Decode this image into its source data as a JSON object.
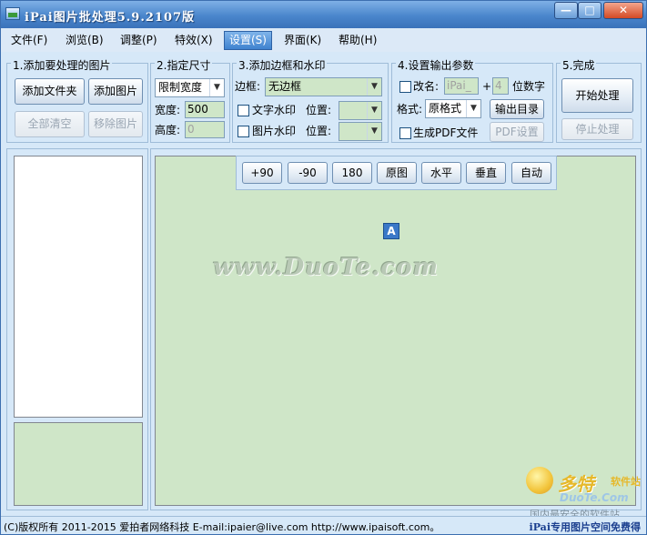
{
  "window": {
    "title": "iPai图片批处理5.9.2107版",
    "min_label": "—",
    "max_label": "□",
    "close_label": "✕"
  },
  "menu": [
    {
      "label": "文件(F)"
    },
    {
      "label": "浏览(B)"
    },
    {
      "label": "调整(P)"
    },
    {
      "label": "特效(X)"
    },
    {
      "label": "设置(S)"
    },
    {
      "label": "界面(K)"
    },
    {
      "label": "帮助(H)"
    }
  ],
  "menu_active_index": 4,
  "step1": {
    "title": "1.添加要处理的图片",
    "add_folder": "添加文件夹",
    "add_image": "添加图片",
    "clear_all": "全部清空",
    "remove_image": "移除图片"
  },
  "step2": {
    "title": "2.指定尺寸",
    "mode": "限制宽度",
    "width_label": "宽度:",
    "width_value": "500",
    "height_label": "高度:",
    "height_value": "0"
  },
  "step3": {
    "title": "3.添加边框和水印",
    "border_label": "边框:",
    "border_value": "无边框",
    "text_watermark": "文字水印",
    "image_watermark": "图片水印",
    "position_label": "位置:"
  },
  "step4": {
    "title": "4.设置输出参数",
    "rename_label": "改名:",
    "rename_value": "iPai_",
    "plus": "+",
    "digits_value": "4",
    "digits_label": "位数字",
    "format_label": "格式:",
    "format_value": "原格式",
    "output_dir": "输出目录",
    "gen_pdf": "生成PDF文件",
    "pdf_settings": "PDF设置"
  },
  "step5": {
    "title": "5.完成",
    "start": "开始处理",
    "stop": "停止处理"
  },
  "toolbar": [
    {
      "label": "+90"
    },
    {
      "label": "-90"
    },
    {
      "label": "180"
    },
    {
      "label": "原图"
    },
    {
      "label": "水平"
    },
    {
      "label": "垂直"
    },
    {
      "label": "自动"
    }
  ],
  "preview": {
    "text_icon_label": "A",
    "watermark": "www.DuoTe.com"
  },
  "status": {
    "left": "(C)版权所有 2011-2015 爱拍者网络科技 E-mail:ipaier@live.com http://www.ipaisoft.com。",
    "right": "iPai专用图片空间免费得"
  },
  "logo": {
    "name": "多特",
    "sub": "软件站",
    "domain": "DuoTe.Com",
    "tagline": "国内最安全的软件站"
  },
  "colors": {
    "accent": "#3f82cf",
    "preview_bg": "#cfe6c8",
    "window_bg": "#d6e8f8"
  }
}
